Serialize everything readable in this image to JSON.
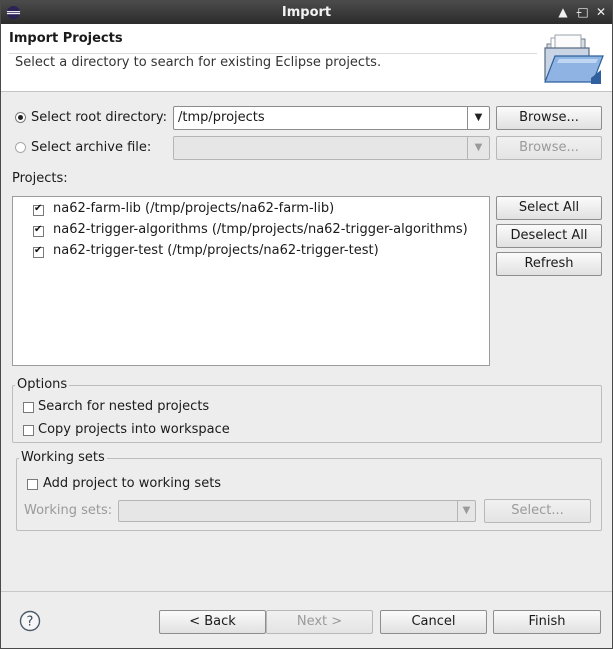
{
  "window": {
    "title": "Import",
    "controls": [
      "▲",
      "–",
      "□",
      "✕"
    ]
  },
  "header": {
    "title": "Import Projects",
    "message": "Select a directory to search for existing Eclipse projects."
  },
  "source": {
    "root_label": "Select root directory:",
    "root_value": "/tmp/projects",
    "archive_label": "Select archive file:",
    "archive_value": "",
    "browse_root": "Browse...",
    "browse_archive": "Browse..."
  },
  "projects": {
    "label": "Projects:",
    "items": [
      {
        "label": "na62-farm-lib (/tmp/projects/na62-farm-lib)",
        "checked": true
      },
      {
        "label": "na62-trigger-algorithms (/tmp/projects/na62-trigger-algorithms)",
        "checked": true
      },
      {
        "label": "na62-trigger-test (/tmp/projects/na62-trigger-test)",
        "checked": true
      }
    ],
    "select_all": "Select All",
    "deselect_all": "Deselect All",
    "refresh": "Refresh"
  },
  "options": {
    "legend": "Options",
    "nested": "Search for nested projects",
    "copy": "Copy projects into workspace"
  },
  "working_sets": {
    "legend": "Working sets",
    "add_label": "Add project to working sets",
    "sets_label": "Working sets:",
    "sets_value": "",
    "select_button": "Select..."
  },
  "footer": {
    "help": "?",
    "back": "< Back",
    "next": "Next >",
    "cancel": "Cancel",
    "finish": "Finish"
  },
  "icons": {
    "app": "eclipse-icon",
    "banner": "folder-icon",
    "help": "help-icon"
  }
}
